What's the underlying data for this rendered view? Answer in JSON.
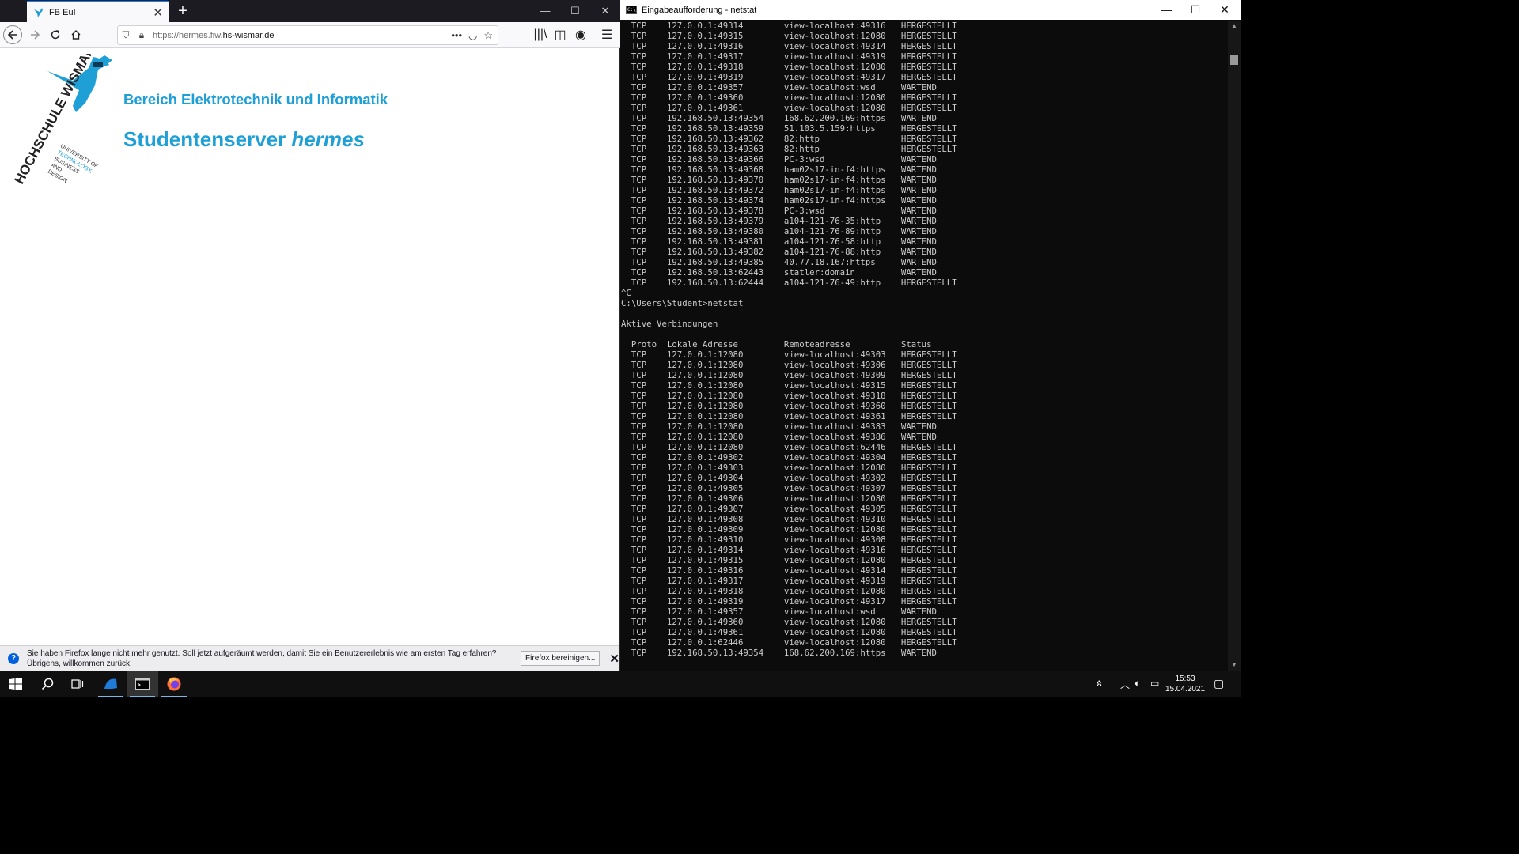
{
  "browser": {
    "tab_title": "FB EuI",
    "url_prefix": "https://hermes.fiw.",
    "url_domain": "hs-wismar.de",
    "page": {
      "department_heading": "Bereich Elektrotechnik und Informatik",
      "server_title": "Studentenserver ",
      "server_title_italic": "hermes",
      "logo": {
        "name": "HOCHSCHULE WISMAR",
        "tagline": [
          "UNIVERSITY OF",
          "TECHNOLOGY,",
          "BUSINESS",
          "AND",
          "DESIGN"
        ]
      }
    },
    "notification": {
      "text": "Sie haben Firefox lange nicht mehr genutzt. Soll jetzt aufgeräumt werden, damit Sie ein Benutzererlebnis wie am ersten Tag erfahren? Übrigens, willkommen zurück!",
      "button": "Firefox bereinigen..."
    }
  },
  "console": {
    "title": "Eingabeaufforderung - netstat",
    "lines": [
      "  TCP    127.0.0.1:49314        view-localhost:49316   HERGESTELLT",
      "  TCP    127.0.0.1:49315        view-localhost:12080   HERGESTELLT",
      "  TCP    127.0.0.1:49316        view-localhost:49314   HERGESTELLT",
      "  TCP    127.0.0.1:49317        view-localhost:49319   HERGESTELLT",
      "  TCP    127.0.0.1:49318        view-localhost:12080   HERGESTELLT",
      "  TCP    127.0.0.1:49319        view-localhost:49317   HERGESTELLT",
      "  TCP    127.0.0.1:49357        view-localhost:wsd     WARTEND",
      "  TCP    127.0.0.1:49360        view-localhost:12080   HERGESTELLT",
      "  TCP    127.0.0.1:49361        view-localhost:12080   HERGESTELLT",
      "  TCP    192.168.50.13:49354    168.62.200.169:https   WARTEND",
      "  TCP    192.168.50.13:49359    51.103.5.159:https     HERGESTELLT",
      "  TCP    192.168.50.13:49362    82:http                HERGESTELLT",
      "  TCP    192.168.50.13:49363    82:http                HERGESTELLT",
      "  TCP    192.168.50.13:49366    PC-3:wsd               WARTEND",
      "  TCP    192.168.50.13:49368    ham02s17-in-f4:https   WARTEND",
      "  TCP    192.168.50.13:49370    ham02s17-in-f4:https   WARTEND",
      "  TCP    192.168.50.13:49372    ham02s17-in-f4:https   WARTEND",
      "  TCP    192.168.50.13:49374    ham02s17-in-f4:https   WARTEND",
      "  TCP    192.168.50.13:49378    PC-3:wsd               WARTEND",
      "  TCP    192.168.50.13:49379    a104-121-76-35:http    WARTEND",
      "  TCP    192.168.50.13:49380    a104-121-76-89:http    WARTEND",
      "  TCP    192.168.50.13:49381    a104-121-76-58:http    WARTEND",
      "  TCP    192.168.50.13:49382    a104-121-76-88:http    WARTEND",
      "  TCP    192.168.50.13:49385    40.77.18.167:https     WARTEND",
      "  TCP    192.168.50.13:62443    statler:domain         WARTEND",
      "  TCP    192.168.50.13:62444    a104-121-76-49:http    HERGESTELLT",
      "^C",
      "C:\\Users\\Student>netstat",
      "",
      "Aktive Verbindungen",
      "",
      "  Proto  Lokale Adresse         Remoteadresse          Status",
      "  TCP    127.0.0.1:12080        view-localhost:49303   HERGESTELLT",
      "  TCP    127.0.0.1:12080        view-localhost:49306   HERGESTELLT",
      "  TCP    127.0.0.1:12080        view-localhost:49309   HERGESTELLT",
      "  TCP    127.0.0.1:12080        view-localhost:49315   HERGESTELLT",
      "  TCP    127.0.0.1:12080        view-localhost:49318   HERGESTELLT",
      "  TCP    127.0.0.1:12080        view-localhost:49360   HERGESTELLT",
      "  TCP    127.0.0.1:12080        view-localhost:49361   HERGESTELLT",
      "  TCP    127.0.0.1:12080        view-localhost:49383   WARTEND",
      "  TCP    127.0.0.1:12080        view-localhost:49386   WARTEND",
      "  TCP    127.0.0.1:12080        view-localhost:62446   HERGESTELLT",
      "  TCP    127.0.0.1:49302        view-localhost:49304   HERGESTELLT",
      "  TCP    127.0.0.1:49303        view-localhost:12080   HERGESTELLT",
      "  TCP    127.0.0.1:49304        view-localhost:49302   HERGESTELLT",
      "  TCP    127.0.0.1:49305        view-localhost:49307   HERGESTELLT",
      "  TCP    127.0.0.1:49306        view-localhost:12080   HERGESTELLT",
      "  TCP    127.0.0.1:49307        view-localhost:49305   HERGESTELLT",
      "  TCP    127.0.0.1:49308        view-localhost:49310   HERGESTELLT",
      "  TCP    127.0.0.1:49309        view-localhost:12080   HERGESTELLT",
      "  TCP    127.0.0.1:49310        view-localhost:49308   HERGESTELLT",
      "  TCP    127.0.0.1:49314        view-localhost:49316   HERGESTELLT",
      "  TCP    127.0.0.1:49315        view-localhost:12080   HERGESTELLT",
      "  TCP    127.0.0.1:49316        view-localhost:49314   HERGESTELLT",
      "  TCP    127.0.0.1:49317        view-localhost:49319   HERGESTELLT",
      "  TCP    127.0.0.1:49318        view-localhost:12080   HERGESTELLT",
      "  TCP    127.0.0.1:49319        view-localhost:49317   HERGESTELLT",
      "  TCP    127.0.0.1:49357        view-localhost:wsd     WARTEND",
      "  TCP    127.0.0.1:49360        view-localhost:12080   HERGESTELLT",
      "  TCP    127.0.0.1:49361        view-localhost:12080   HERGESTELLT",
      "  TCP    127.0.0.1:62446        view-localhost:12080   HERGESTELLT",
      "  TCP    192.168.50.13:49354    168.62.200.169:https   WARTEND"
    ]
  },
  "taskbar": {
    "time": "15:53",
    "date": "15.04.2021"
  }
}
